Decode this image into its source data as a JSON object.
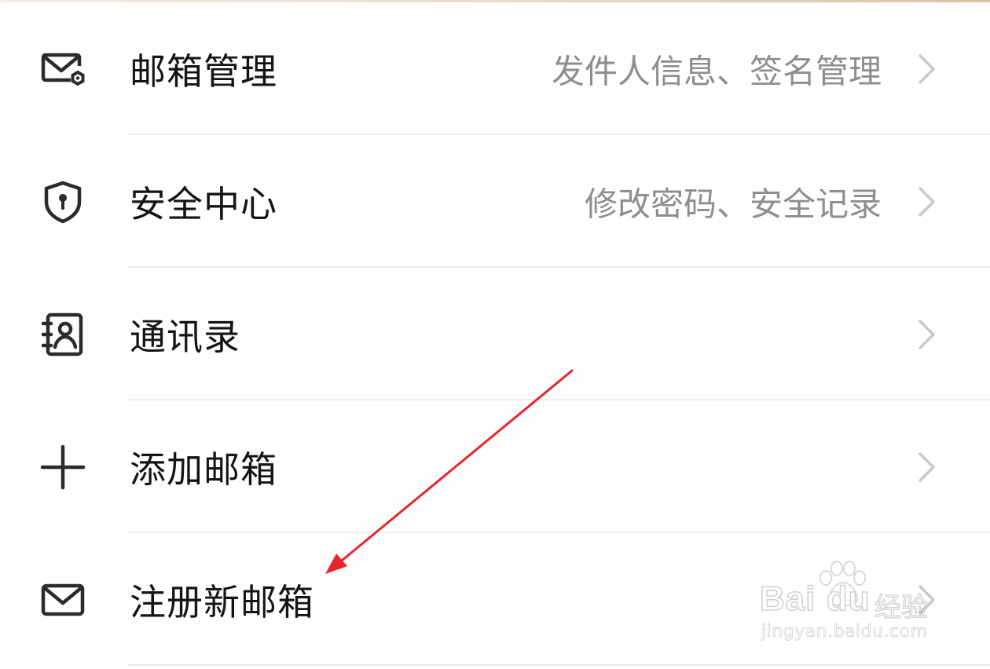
{
  "settings": {
    "items": [
      {
        "label": "邮箱管理",
        "detail": "发件人信息、签名管理",
        "icon": "mail-settings-icon"
      },
      {
        "label": "安全中心",
        "detail": "修改密码、安全记录",
        "icon": "shield-lock-icon"
      },
      {
        "label": "通讯录",
        "detail": "",
        "icon": "contacts-book-icon"
      },
      {
        "label": "添加邮箱",
        "detail": "",
        "icon": "plus-icon"
      },
      {
        "label": "注册新邮箱",
        "detail": "",
        "icon": "mail-icon"
      }
    ]
  },
  "annotation": {
    "arrow_color": "#e8262a",
    "points_to": "注册新邮箱"
  },
  "watermark": {
    "brand": "Bai du",
    "brand_cn": "经验",
    "url": "jingyan.baidu.com"
  }
}
